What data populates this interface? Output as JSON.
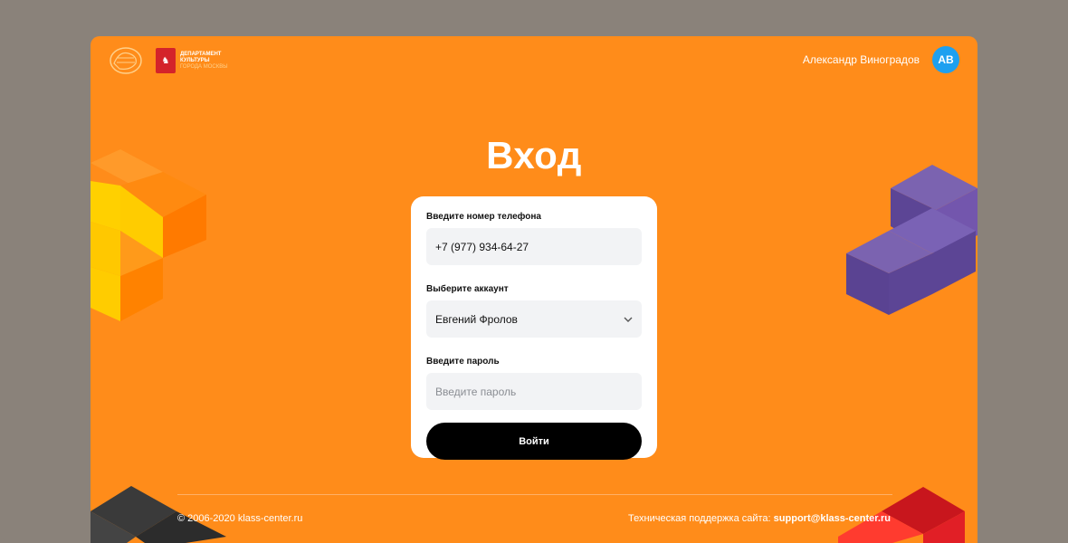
{
  "header": {
    "dept_line1": "ДЕПАРТАМЕНТ",
    "dept_line2": "КУЛЬТУРЫ",
    "dept_line3": "ГОРОДА МОСКВЫ",
    "user_name": "Александр Виноградов",
    "avatar_initials": "AB"
  },
  "page": {
    "title": "Вход"
  },
  "form": {
    "phone_label": "Введите номер телефона",
    "phone_value": "+7 (977) 934-64-27",
    "account_label": "Выберите аккаунт",
    "account_value": "Евгений Фролов",
    "password_label": "Введите пароль",
    "password_placeholder": "Введите пароль",
    "login_button": "Войти"
  },
  "footer": {
    "copyright": "© 2006-2020 klass-center.ru",
    "support_label": "Техническая поддержка сайта:",
    "support_email": "support@klass-center.ru"
  },
  "colors": {
    "background": "#ff8c1a",
    "avatar": "#1ea0f0",
    "button": "#000000"
  }
}
